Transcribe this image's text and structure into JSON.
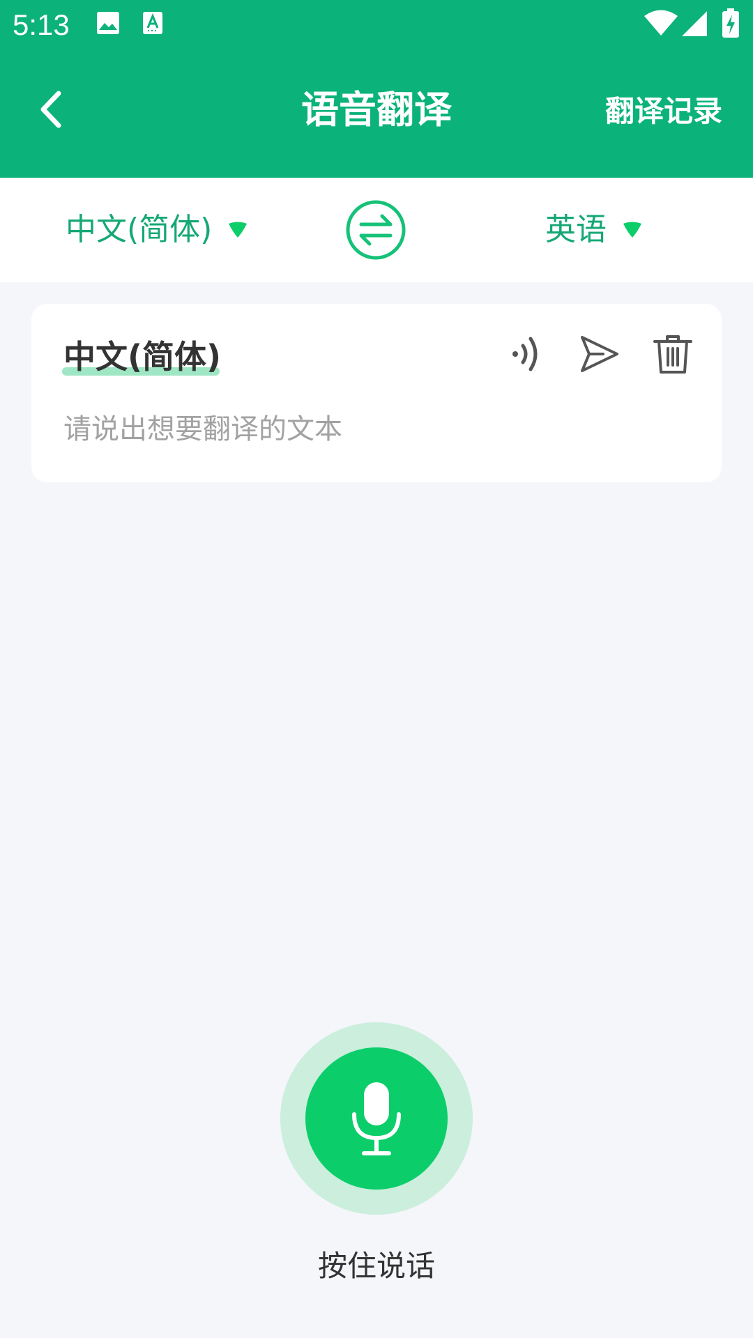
{
  "status_bar": {
    "time": "5:13",
    "icons": [
      "image-icon",
      "text-a-icon",
      "wifi-icon",
      "cell-signal-icon",
      "battery-icon"
    ]
  },
  "nav": {
    "title": "语音翻译",
    "history_label": "翻译记录",
    "back_icon": "back-arrow-icon"
  },
  "lang_bar": {
    "source_lang": "中文(简体)",
    "target_lang": "英语",
    "swap_icon": "swap-arrows-icon"
  },
  "card": {
    "lang": "中文(简体)",
    "placeholder": "请说出想要翻译的文本",
    "tools": [
      "speaker-icon",
      "send-icon",
      "trash-icon"
    ]
  },
  "mic": {
    "label": "按住说话",
    "icon": "microphone-icon"
  },
  "colors": {
    "brand_green": "#0bb27a",
    "mic_green": "#0bce6a",
    "accent_text": "#15a874",
    "background": "#f4f6fa"
  }
}
